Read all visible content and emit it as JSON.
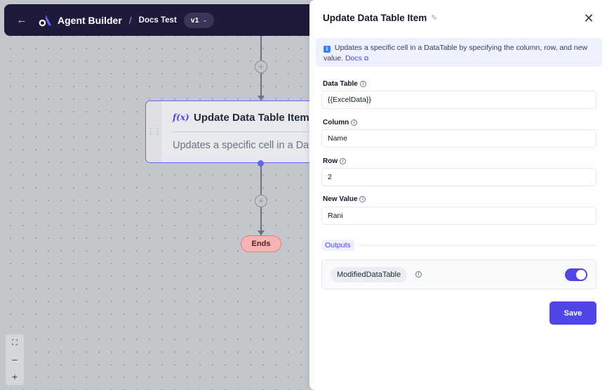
{
  "header": {
    "app_title": "Agent Builder",
    "separator": "/",
    "breadcrumb": "Docs Test",
    "version": "v1"
  },
  "canvas": {
    "node": {
      "icon": "f(x)",
      "title": "Update Data Table Item",
      "description": "Updates a specific cell in a DataTable"
    },
    "end_node": "Ends",
    "zoom": {
      "fit": "⛶",
      "zoom_out": "−",
      "zoom_in": "+"
    }
  },
  "panel": {
    "title": "Update Data Table Item",
    "info_text": "Updates a specific cell in a DataTable by specifying the column, row, and new value.",
    "docs_label": "Docs",
    "fields": [
      {
        "label": "Data Table",
        "value": "{{ExcelData}}"
      },
      {
        "label": "Column",
        "value": "Name"
      },
      {
        "label": "Row",
        "value": "2"
      },
      {
        "label": "New Value",
        "value": "Rani"
      }
    ],
    "outputs_label": "Outputs",
    "outputs": [
      {
        "name": "ModifiedDataTable",
        "enabled": true
      }
    ],
    "save_label": "Save"
  },
  "colors": {
    "accent": "#4f46e5",
    "header_bg": "#1e1b3a",
    "end_node": "#f6b3b3"
  }
}
